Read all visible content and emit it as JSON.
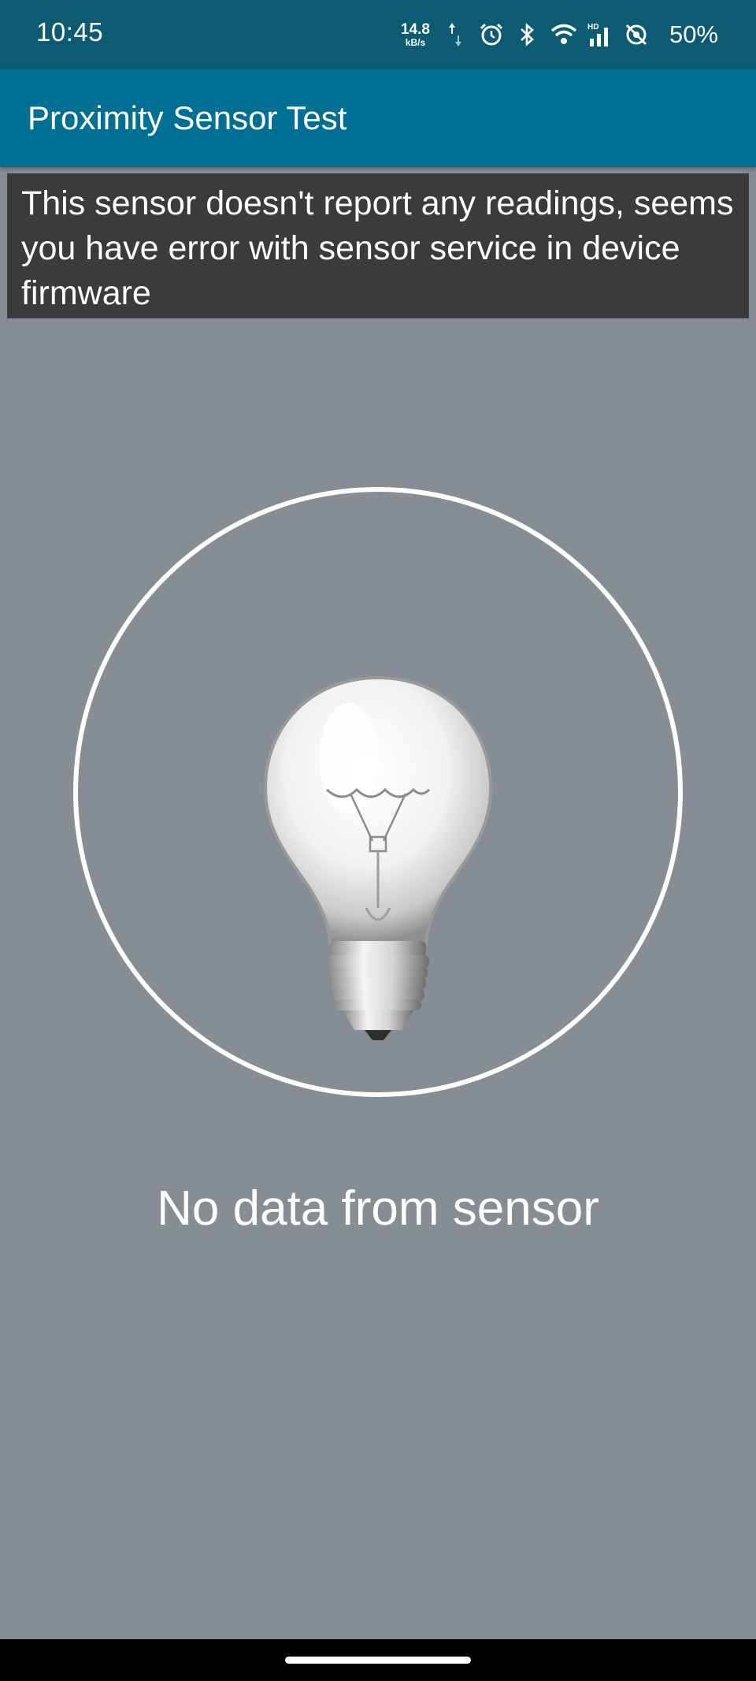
{
  "status_bar": {
    "time": "10:45",
    "net_speed_value": "14.8",
    "net_speed_unit": "kB/s",
    "battery_percent": "50%",
    "icons": [
      "upload-download-icon",
      "alarm-icon",
      "bluetooth-icon",
      "wifi-icon",
      "signal-hd-icon",
      "no-location-icon"
    ]
  },
  "app_bar": {
    "title": "Proximity Sensor Test"
  },
  "error_message": "This sensor doesn't report any readings, seems you have error with sensor service in device firmware",
  "sensor_display": {
    "icon": "light-bulb-icon",
    "status_text": "No data from sensor"
  },
  "colors": {
    "status_bar": "#0d5b72",
    "app_bar": "#006f94",
    "background": "#878d94",
    "error_box": "#3a3b3c"
  }
}
